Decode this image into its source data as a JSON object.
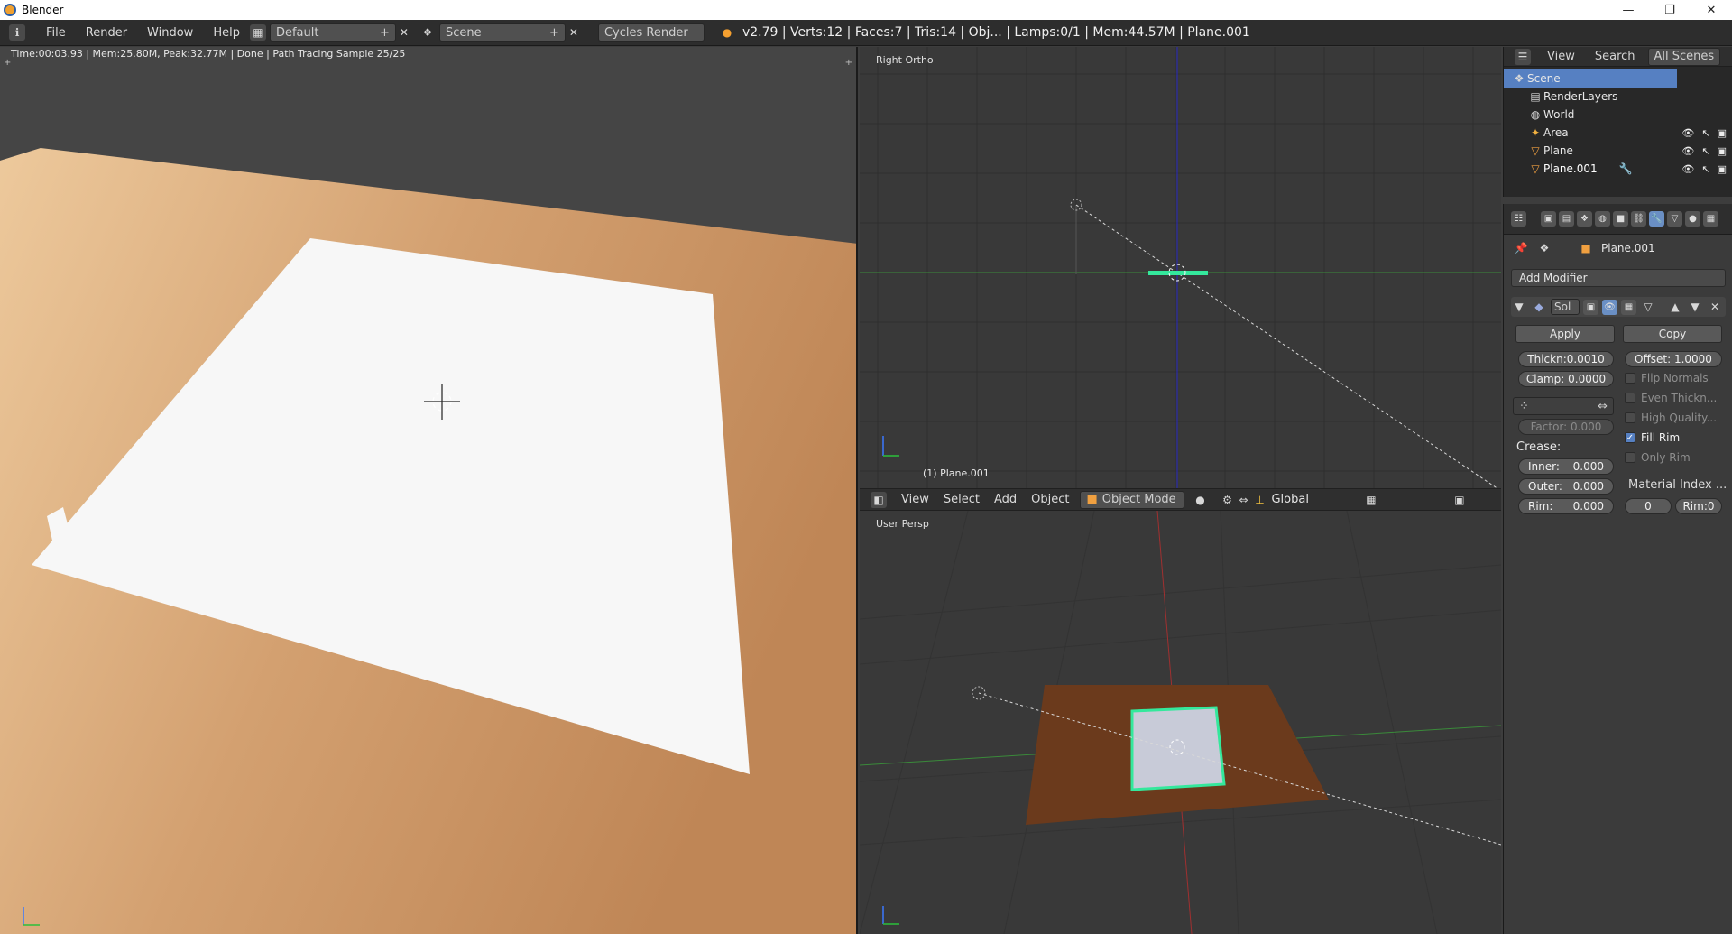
{
  "window": {
    "title": "Blender",
    "minimize": "—",
    "maximize": "❐",
    "close": "✕"
  },
  "menu": {
    "items": [
      "File",
      "Render",
      "Window",
      "Help"
    ],
    "layout": "Default",
    "scene": "Scene",
    "engine": "Cycles Render"
  },
  "stats": "v2.79 | Verts:12 | Faces:7 | Tris:14 | Obj... | Lamps:0/1 | Mem:44.57M | Plane.001",
  "render_view": {
    "status": "Time:00:03.93 | Mem:25.80M, Peak:32.77M | Done | Path Tracing Sample 25/25"
  },
  "ortho_view": {
    "label": "Right Ortho",
    "object_label": "(1) Plane.001"
  },
  "persp_view": {
    "label": "User Persp"
  },
  "header3d": {
    "view": "View",
    "select": "Select",
    "add": "Add",
    "object": "Object",
    "mode": "Object Mode",
    "orientation": "Global"
  },
  "outliner": {
    "view": "View",
    "search": "Search",
    "scenes": "All Scenes",
    "rows": [
      "Scene",
      "RenderLayers",
      "World",
      "Area",
      "Plane",
      "Plane.001"
    ]
  },
  "props": {
    "object": "Plane.001",
    "add_modifier": "Add Modifier",
    "modifier_name": "Sol",
    "apply": "Apply",
    "copy": "Copy",
    "thickness": "Thickn:0.0010",
    "offset": "Offset: 1.0000",
    "clamp": "Clamp: 0.0000",
    "factor": "Factor:    0.000",
    "flip_normals": "Flip Normals",
    "even_thickness": "Even Thickn...",
    "high_quality": "High Quality...",
    "fill_rim": "Fill Rim",
    "only_rim": "Only Rim",
    "crease": "Crease:",
    "inner": "Inner:",
    "inner_val": "0.000",
    "outer": "Outer:",
    "outer_val": "0.000",
    "rim": "Rim:",
    "rim_val": "0.000",
    "material_index": "Material Index ...",
    "mat_val": "0",
    "mat_rim": "Rim:0"
  },
  "colors": {
    "accent": "#5680c2",
    "selection": "#34e89c",
    "floor": "#c99664",
    "paper": "#ffffff"
  }
}
